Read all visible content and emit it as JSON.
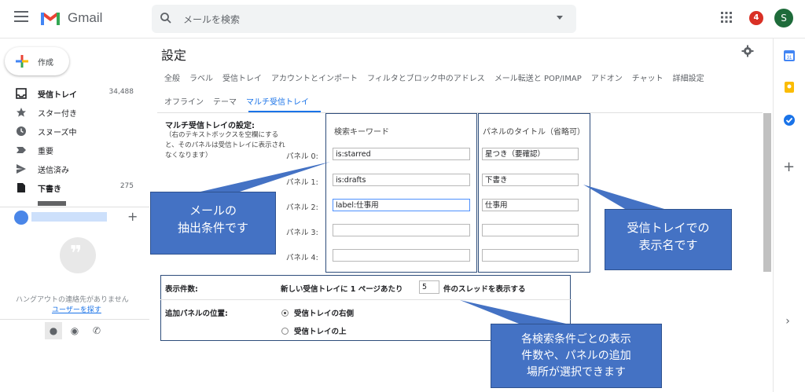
{
  "app": {
    "name": "Gmail",
    "brand_color": "#ea4335",
    "accent": "#1a73e8"
  },
  "header": {
    "search_placeholder": "メールを検索",
    "notification_count": "4",
    "avatar_initial": "S"
  },
  "sidebar": {
    "compose_label": "作成",
    "items": [
      {
        "label": "受信トレイ",
        "count": "34,488",
        "icon": "inbox-icon"
      },
      {
        "label": "スター付き",
        "count": "",
        "icon": "star-icon"
      },
      {
        "label": "スヌーズ中",
        "count": "",
        "icon": "clock-icon"
      },
      {
        "label": "重要",
        "count": "",
        "icon": "important-icon"
      },
      {
        "label": "送信済み",
        "count": "",
        "icon": "send-icon"
      },
      {
        "label": "下書き",
        "count": "275",
        "icon": "draft-icon"
      }
    ],
    "hangouts_message": "ハングアウトの連絡先がありません",
    "hangouts_link": "ユーザーを探す"
  },
  "settings": {
    "title": "設定",
    "tabs_row1": [
      "全般",
      "ラベル",
      "受信トレイ",
      "アカウントとインポート",
      "フィルタとブロック中のアドレス",
      "メール転送と POP/IMAP",
      "アドオン",
      "チャット",
      "詳細設定"
    ],
    "tabs_row2": [
      "オフライン",
      "テーマ",
      "マルチ受信トレイ"
    ],
    "active_tab": "マルチ受信トレイ",
    "multi_inbox": {
      "heading": "マルチ受信トレイの設定:",
      "note": "（右のテキストボックスを空欄にすると、そのパネルは受信トレイに表示されなくなります）",
      "col_query": "検索キーワード",
      "col_title": "パネルのタイトル（省略可）",
      "panels": [
        {
          "label": "パネル 0:",
          "query": "is:starred",
          "title": "星つき（要確認）"
        },
        {
          "label": "パネル 1:",
          "query": "is:drafts",
          "title": "下書き"
        },
        {
          "label": "パネル 2:",
          "query": "label:仕事用",
          "title": "仕事用"
        },
        {
          "label": "パネル 3:",
          "query": "",
          "title": ""
        },
        {
          "label": "パネル 4:",
          "query": "",
          "title": ""
        }
      ]
    },
    "display": {
      "label": "表示件数:",
      "pre": "新しい受信トレイに 1 ページあたり",
      "value": "5",
      "post": "件のスレッドを表示する"
    },
    "position": {
      "label": "追加パネルの位置:",
      "options": [
        "受信トレイの右側",
        "受信トレイの上"
      ],
      "selected": "受信トレイの右側"
    }
  },
  "callouts": {
    "query": "メールの\n抽出条件です",
    "title": "受信トレイでの\n表示名です",
    "options": "各検索条件ごとの表示\n件数や、パネルの追加\n場所が選択できます"
  }
}
